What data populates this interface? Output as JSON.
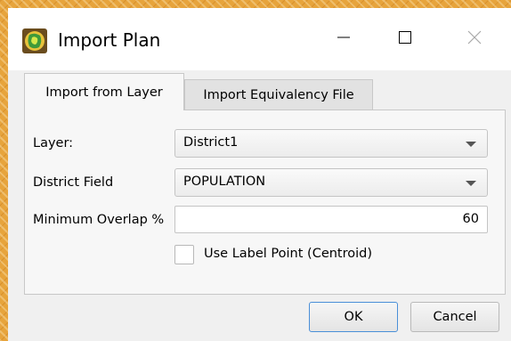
{
  "window": {
    "title": "Import Plan"
  },
  "icons": {
    "app": "qgis-redistricting-icon",
    "minimize": "minimize-icon",
    "maximize": "maximize-icon",
    "close": "close-icon",
    "dropdown": "chevron-down-icon"
  },
  "tabs": [
    {
      "label": "Import from Layer",
      "active": true
    },
    {
      "label": "Import Equivalency File",
      "active": false
    }
  ],
  "form": {
    "layer_label": "Layer:",
    "layer_value": "District1",
    "district_field_label": "District Field",
    "district_field_value": "POPULATION",
    "overlap_label": "Minimum Overlap %",
    "overlap_value": "60",
    "centroid_label": "Use Label Point (Centroid)",
    "centroid_checked": false
  },
  "buttons": {
    "ok": "OK",
    "cancel": "Cancel"
  },
  "colors": {
    "background_map": "#e7a43c",
    "dialog": "#f0f0f0",
    "titlebar": "#ffffff",
    "ok_focus_border": "#4a8fd8"
  }
}
